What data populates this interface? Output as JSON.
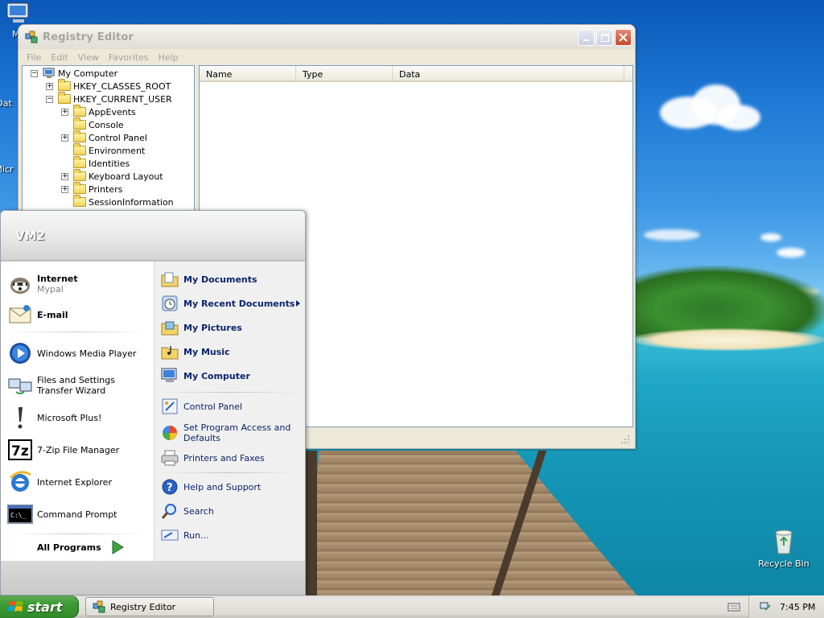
{
  "desktop": {
    "icons": {
      "my_computer": "My",
      "data": "Dat",
      "micro": "Micr",
      "recycle_bin": "Recycle Bin"
    }
  },
  "registry_window": {
    "title": "Registry Editor",
    "menu": [
      "File",
      "Edit",
      "View",
      "Favorites",
      "Help"
    ],
    "tree": {
      "root": "My Computer",
      "hkcr": "HKEY_CLASSES_ROOT",
      "hkcu": "HKEY_CURRENT_USER",
      "children": [
        "AppEvents",
        "Console",
        "Control Panel",
        "Environment",
        "Identities",
        "Keyboard Layout",
        "Printers",
        "SessionInformation"
      ]
    },
    "columns": [
      "Name",
      "Type",
      "Data"
    ]
  },
  "start_menu": {
    "user": "VM2",
    "pinned": [
      {
        "title": "Internet",
        "subtitle": "Mypal"
      },
      {
        "title": "E-mail"
      }
    ],
    "recent": [
      "Windows Media Player",
      "Files and Settings Transfer Wizard",
      "Microsoft Plus!",
      "7-Zip File Manager",
      "Internet Explorer",
      "Command Prompt"
    ],
    "all_programs": "All Programs",
    "places": [
      "My Documents",
      "My Recent Documents",
      "My Pictures",
      "My Music",
      "My Computer"
    ],
    "settings": [
      "Control Panel",
      "Set Program Access and Defaults",
      "Printers and Faxes"
    ],
    "actions": [
      "Help and Support",
      "Search",
      "Run..."
    ]
  },
  "taskbar": {
    "start_label": "start",
    "task": "Registry Editor",
    "clock": "7:45 PM"
  }
}
